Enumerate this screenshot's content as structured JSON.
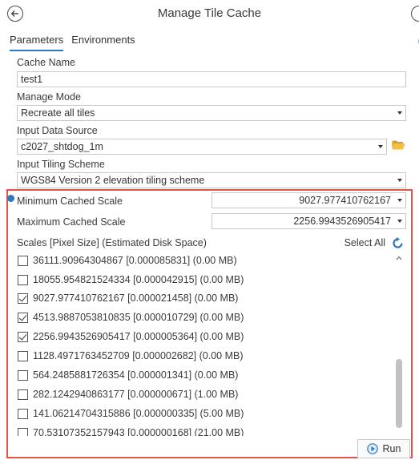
{
  "header": {
    "title": "Manage Tile Cache"
  },
  "tabs": [
    {
      "label": "Parameters",
      "active": true
    },
    {
      "label": "Environments",
      "active": false
    }
  ],
  "params": {
    "cache_name": {
      "label": "Cache Name",
      "value": "test1"
    },
    "manage_mode": {
      "label": "Manage Mode",
      "value": "Recreate all tiles"
    },
    "input_data_source": {
      "label": "Input Data Source",
      "value": "c2027_shtdog_1m"
    },
    "input_tiling_scheme": {
      "label": "Input Tiling Scheme",
      "value": "WGS84 Version 2 elevation tiling scheme"
    },
    "min_cached_scale": {
      "label": "Minimum Cached Scale",
      "value": "9027.977410762167"
    },
    "max_cached_scale": {
      "label": "Maximum Cached Scale",
      "value": "2256.9943526905417"
    }
  },
  "scales": {
    "header": "Scales [Pixel Size] (Estimated Disk Space)",
    "select_all": "Select All",
    "items": [
      {
        "label": "36111.90964304867 [0.000085831] (0.00 MB)",
        "checked": false
      },
      {
        "label": "18055.954821524334 [0.000042915] (0.00 MB)",
        "checked": false
      },
      {
        "label": "9027.977410762167 [0.000021458] (0.00 MB)",
        "checked": true
      },
      {
        "label": "4513.9887053810835 [0.000010729] (0.00 MB)",
        "checked": true
      },
      {
        "label": "2256.9943526905417 [0.000005364] (0.00 MB)",
        "checked": true
      },
      {
        "label": "1128.4971763452709 [0.000002682] (0.00 MB)",
        "checked": false
      },
      {
        "label": "564.2485881726354 [0.000001341] (0.00 MB)",
        "checked": false
      },
      {
        "label": "282.1242940863177 [0.000000671] (1.00 MB)",
        "checked": false
      },
      {
        "label": "141.06214704315886 [0.000000335] (5.00 MB)",
        "checked": false
      },
      {
        "label": "70.53107352157943 [0.000000168] (21.00 MB)",
        "checked": false
      }
    ]
  },
  "footer": {
    "run_label": "Run"
  },
  "colors": {
    "accent": "#2b79c2",
    "highlight": "#e0554b"
  },
  "icons": {
    "back": "back-arrow-icon",
    "folder": "folder-icon",
    "refresh": "refresh-icon",
    "run": "run-icon"
  }
}
